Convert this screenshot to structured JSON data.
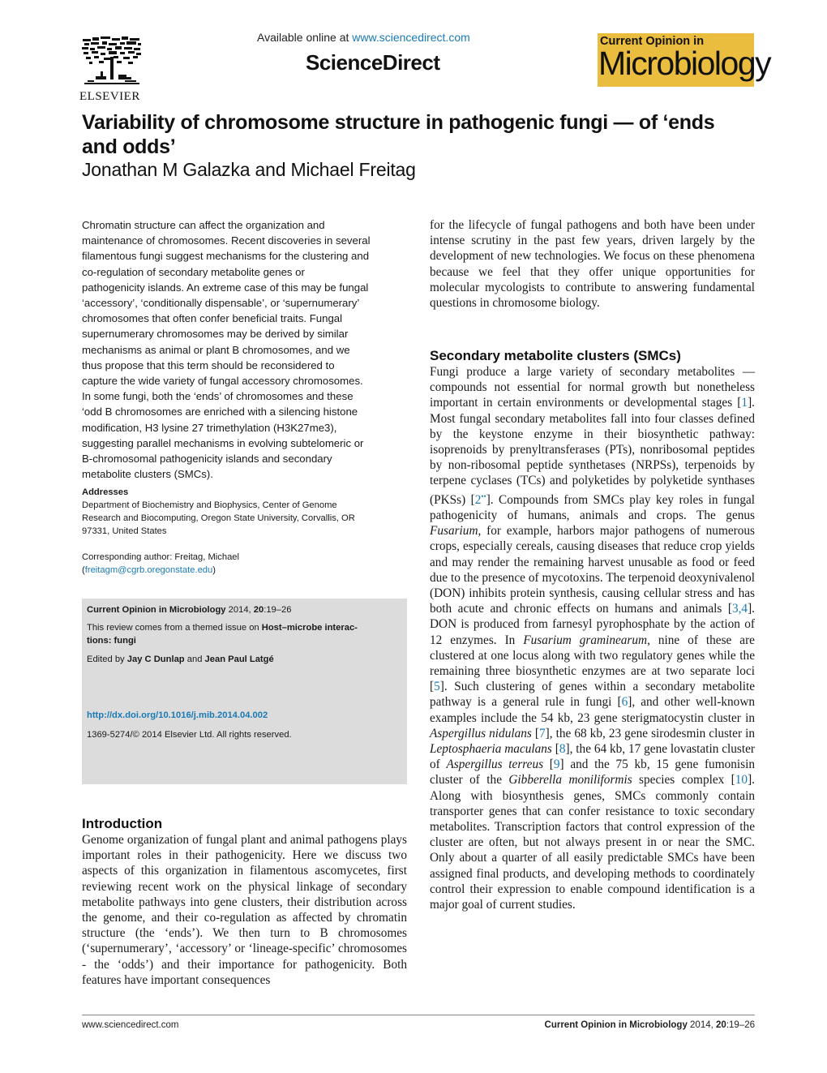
{
  "header": {
    "publisher": "ELSEVIER",
    "available_online_prefix": "Available online at ",
    "available_online_link": "www.sciencedirect.com",
    "platform": "ScienceDirect",
    "journal_badge_top": "Current Opinion in",
    "journal_badge_name": "Microbiology",
    "badge_color": "#ebbd3e",
    "link_color": "#1a7ab5"
  },
  "article": {
    "title": "Variability of chromosome structure in pathogenic fungi — of ‘ends and odds’",
    "authors": "Jonathan M Galazka and Michael Freitag"
  },
  "abstract": "Chromatin structure can affect the organization and maintenance of chromosomes. Recent discoveries in several filamentous fungi suggest mechanisms for the clustering and co-regulation of secondary metabolite genes or pathogenicity islands. An extreme case of this may be fungal ‘accessory’, ‘conditionally dispensable’, or ‘supernumerary’ chromosomes that often confer beneficial traits. Fungal supernumerary chromosomes may be derived by similar mechanisms as animal or plant B chromosomes, and we thus propose that this term should be reconsidered to capture the wide variety of fungal accessory chromosomes. In some fungi, both the ‘ends’ of chromosomes and these ‘odd B chromosomes are enriched with a silencing histone modification, H3 lysine 27 trimethylation (H3K27me3), suggesting parallel mechanisms in evolving subtelomeric or B-chromosomal pathogenicity islands and secondary metabolite clusters (SMCs).",
  "abstract_lines": [
    "Chromatin structure can affect the organization and",
    "maintenance of chromosomes. Recent discoveries in several",
    "filamentous fungi suggest mechanisms for the clustering and",
    "co-regulation of secondary metabolite genes or",
    "pathogenicity islands. An extreme case of this may be fungal",
    "‘accessory’, ‘conditionally dispensable’, or ‘supernumerary’",
    "chromosomes that often confer beneficial traits. Fungal",
    "supernumerary chromosomes may be derived by similar",
    "mechanisms as animal or plant B chromosomes, and we",
    "thus propose that this term should be reconsidered to",
    "capture the wide variety of fungal accessory chromosomes.",
    "In some fungi, both the ‘ends’ of chromosomes and these",
    "‘odd B chromosomes are enriched with a silencing histone",
    "modification, H3 lysine 27 trimethylation (H3K27me3),",
    "suggesting parallel mechanisms in evolving subtelomeric or",
    "B-chromosomal pathogenicity islands and secondary",
    "metabolite clusters (SMCs)."
  ],
  "addresses": {
    "heading": "Addresses",
    "lines": [
      "Department of Biochemistry and Biophysics, Center of Genome",
      "Research and Biocomputing, Oregon State University, Corvallis, OR",
      "97331, United States"
    ]
  },
  "corresponding": {
    "label": "Corresponding author: Freitag, Michael",
    "email_open": "(",
    "email": "freitagm@cgrb.oregonstate.edu",
    "email_close": ")"
  },
  "infobox": {
    "journal": "Current Opinion in Microbiology",
    "year_vol": " 2014, ",
    "volume": "20",
    "pages": ":19–26",
    "theme_prefix": "This review comes from a themed issue on ",
    "theme_line1": "Host–microbe interac-",
    "theme_line2": "tions: fungi",
    "edited_prefix": "Edited by ",
    "editor1": "Jay C Dunlap",
    "editors_and": " and ",
    "editor2": "Jean Paul Latgé",
    "doi": "http://dx.doi.org/10.1016/j.mib.2014.04.002",
    "copyright": "1369-5274/© 2014 Elsevier Ltd. All rights reserved.",
    "bg_color": "#dcdcdc"
  },
  "introduction": {
    "heading": "Introduction",
    "text_left": "Genome organization of fungal plant and animal pathogens plays important roles in their pathogenicity. Here we discuss two aspects of this organization in filamentous ascomycetes, first reviewing recent work on the physical linkage of secondary metabolite pathways into gene clusters, their distribution across the genome, and their co-regulation as affected by chromatin structure (the ‘ends’). We then turn to B chromosomes (‘supernumerary’, ‘accessory’ or ‘lineage-specific’ chromosomes - the ‘odds’) and their importance for pathogenicity. Both features have important consequences",
    "text_right": "for the lifecycle of fungal pathogens and both have been under intense scrutiny in the past few years, driven largely by the development of new technologies. We focus on these phenomena because we feel that they offer unique opportunities for molecular mycologists to contribute to answering fundamental questions in chromosome biology."
  },
  "smc": {
    "heading": "Secondary metabolite clusters (SMCs)",
    "segments": [
      {
        "t": "Fungi produce a large variety of secondary metabolites — compounds not essential for normal growth but nonetheless important in certain environments or developmental stages "
      },
      {
        "t": "[",
        "k": "n"
      },
      {
        "t": "1",
        "k": "ref"
      },
      {
        "t": "]",
        "k": "n"
      },
      {
        "t": ". Most fungal secondary metabolites fall into four classes defined by the keystone enzyme in their biosynthetic pathway: isoprenoids by prenyltransferases (PTs), nonribosomal peptides by non-ribosomal peptide synthetases (NRPSs), terpenoids by terpene cyclases (TCs) and polyketides by polyketide synthases (PKSs) ["
      },
      {
        "t": "2••",
        "k": "ref"
      },
      {
        "t": "]. Compounds from SMCs play key roles in fungal pathogenicity of humans, animals and crops. The genus "
      },
      {
        "t": "Fusarium",
        "k": "i"
      },
      {
        "t": ", for example, harbors major pathogens of numerous crops, especially cereals, causing diseases that reduce crop yields and may render the remaining harvest unusable as food or feed due to the presence of mycotoxins. The terpenoid deoxynivalenol (DON) inhibits protein synthesis, causing cellular stress and has both acute and chronic effects on humans and animals ["
      },
      {
        "t": "3,4",
        "k": "ref"
      },
      {
        "t": "]. DON is produced from farnesyl pyrophosphate by the action of 12 enzymes. In "
      },
      {
        "t": "Fusarium graminearum",
        "k": "i"
      },
      {
        "t": ", nine of these are clustered at one locus along with two regulatory genes while the remaining three biosynthetic enzymes are at two separate loci ["
      },
      {
        "t": "5",
        "k": "ref"
      },
      {
        "t": "]. Such clustering of genes within a secondary metabolite pathway is a general rule in fungi ["
      },
      {
        "t": "6",
        "k": "ref"
      },
      {
        "t": "], and other well-known examples include the 54 kb, 23 gene sterigmatocystin cluster in "
      },
      {
        "t": "Aspergillus nidulans",
        "k": "i"
      },
      {
        "t": " ["
      },
      {
        "t": "7",
        "k": "ref"
      },
      {
        "t": "], the 68 kb, 23 gene sirodesmin cluster in "
      },
      {
        "t": "Leptosphaeria maculans",
        "k": "i"
      },
      {
        "t": " ["
      },
      {
        "t": "8",
        "k": "ref"
      },
      {
        "t": "], the 64 kb, 17 gene lovastatin cluster of "
      },
      {
        "t": "Aspergillus terreus",
        "k": "i"
      },
      {
        "t": " ["
      },
      {
        "t": "9",
        "k": "ref"
      },
      {
        "t": "] and the 75 kb, 15 gene fumonisin cluster of the "
      },
      {
        "t": "Gibberella moniliformis",
        "k": "i"
      },
      {
        "t": " species complex ["
      },
      {
        "t": "10",
        "k": "ref"
      },
      {
        "t": "]. Along with biosynthesis genes, SMCs commonly contain transporter genes that can confer resistance to toxic secondary metabolites. Transcription factors that control expression of the cluster are often, but not always present in or near the SMC. Only about a quarter of all easily predictable SMCs have been assigned final products, and developing methods to coordinately control their expression to enable compound identification is a major goal of current studies."
      }
    ]
  },
  "footer": {
    "left": "www.sciencedirect.com",
    "journal": "Current Opinion in Microbiology",
    "year": " 2014, ",
    "volume": "20",
    "pages": ":19–26"
  }
}
